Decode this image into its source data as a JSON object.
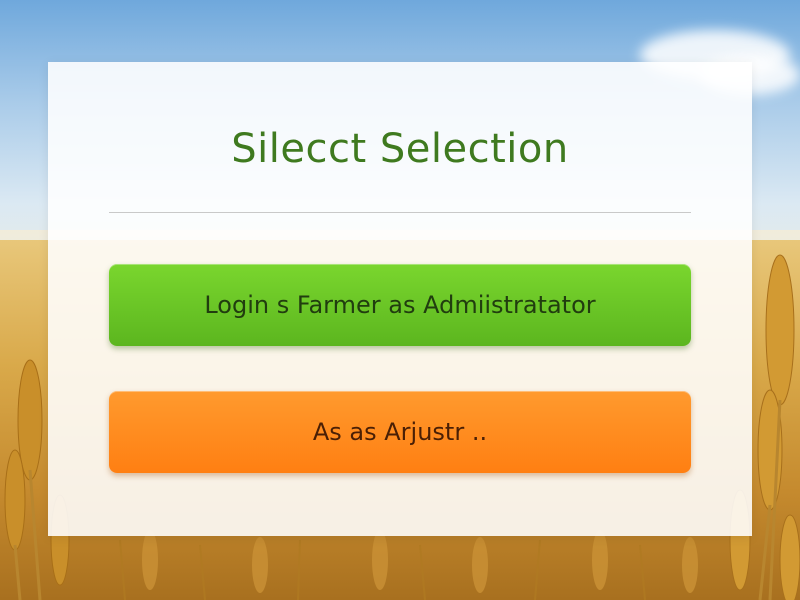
{
  "panel": {
    "title": "Silecct Selection"
  },
  "buttons": [
    {
      "label": "Login s Farmer as  Admiistratator",
      "color": "#6cc625"
    },
    {
      "label": "As as Arjustr ..",
      "color": "#ff8a1e"
    }
  ],
  "theme": {
    "title_color": "#3f7a1f",
    "background": "wheat field under blue sky"
  }
}
